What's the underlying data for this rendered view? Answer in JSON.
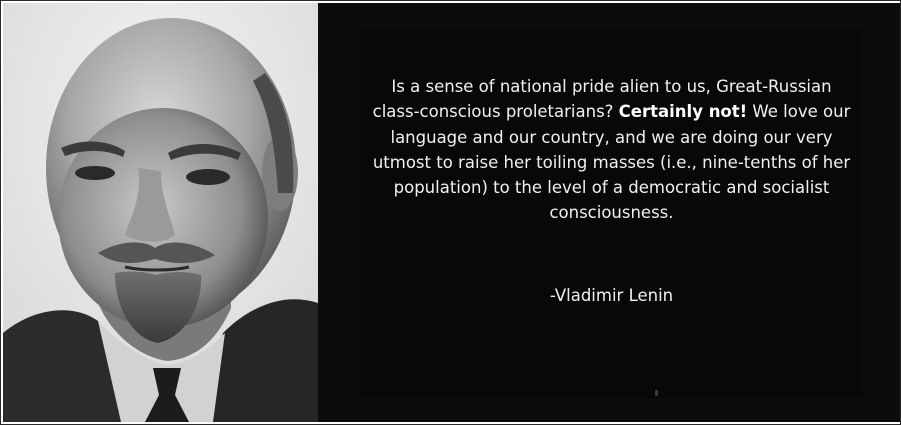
{
  "quote": {
    "text_before": "Is a sense of national pride alien to us, Great-Russian class-conscious proletarians? ",
    "emphasis": "Certainly not!",
    "text_after": " We love our language and our country, and we are doing our very utmost to raise her toiling masses (i.e., nine-tenths of her population) to the level of a democratic and socialist consciousness."
  },
  "author": "-Vladimir Lenin",
  "colors": {
    "panel_background": "#0c0c0c",
    "quote_text": "#f1f1f1",
    "photo_tone": "grayscale"
  }
}
